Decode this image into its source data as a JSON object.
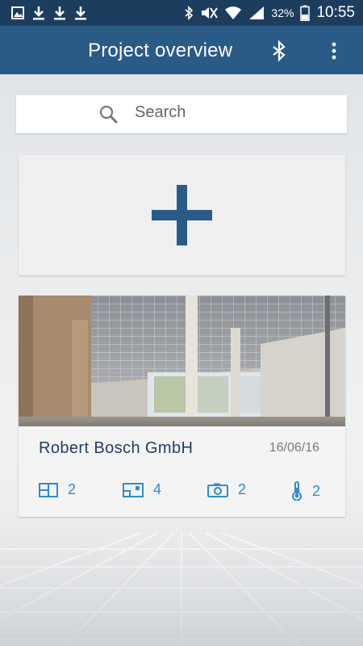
{
  "status_bar": {
    "battery": "32%",
    "time": "10:55",
    "icons": [
      "image-icon",
      "download-icon",
      "download-icon",
      "download-icon",
      "bluetooth-icon",
      "mute-icon",
      "wifi-icon",
      "signal-icon",
      "battery-icon"
    ]
  },
  "app_bar": {
    "title": "Project overview",
    "icons": [
      "bluetooth-icon",
      "more-vert-icon"
    ]
  },
  "search": {
    "placeholder": "Search"
  },
  "add_project": {
    "icon": "plus-icon"
  },
  "project": {
    "name": "Robert Bosch GmbH",
    "date": "16/06/16",
    "stats": [
      {
        "icon": "floorplan-icon",
        "value": "2"
      },
      {
        "icon": "room-icon",
        "value": "4"
      },
      {
        "icon": "camera-icon",
        "value": "2"
      },
      {
        "icon": "thermometer-icon",
        "value": "2"
      }
    ]
  },
  "colors": {
    "status_bar": "#1d3d5f",
    "app_bar": "#2a5b87",
    "accent": "#2f8bd5",
    "plus": "#2a5b87"
  }
}
